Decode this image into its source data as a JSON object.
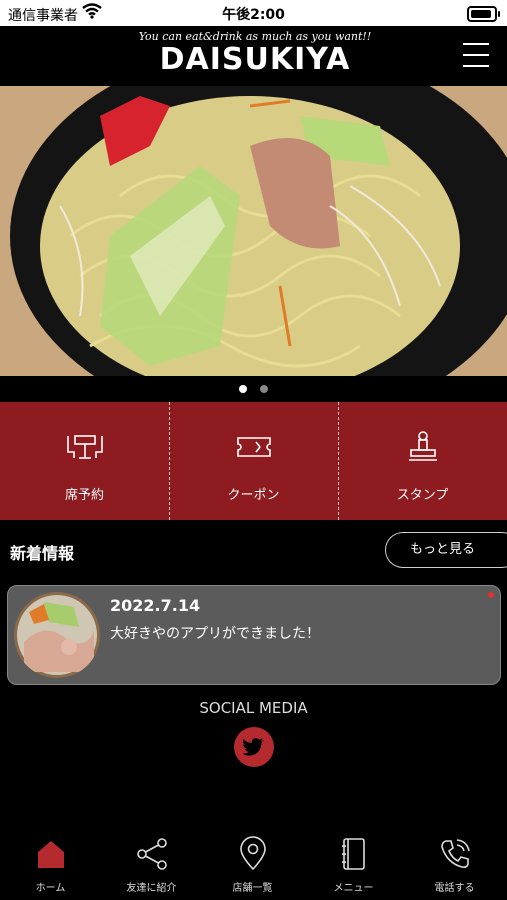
{
  "status_bar": {
    "carrier": "通信事業者",
    "time": "午後2:00"
  },
  "header": {
    "logo_tagline": "You can eat&drink as much as you want!!",
    "logo_name": "DAISUKIYA"
  },
  "hero": {
    "slides_total": 2,
    "active_slide": 1
  },
  "quick_actions": [
    {
      "label": "席予約",
      "icon": "reservation-table-icon"
    },
    {
      "label": "クーポン",
      "icon": "coupon-ticket-icon"
    },
    {
      "label": "スタンプ",
      "icon": "stamp-icon"
    }
  ],
  "news": {
    "section_title": "新着情報",
    "more_label": "もっと見る",
    "items": [
      {
        "date": "2022.7.14",
        "text": "大好きやのアプリができました！",
        "unread": true
      }
    ]
  },
  "social": {
    "title": "SOCIAL MEDIA",
    "icon": "twitter-icon"
  },
  "tabbar": [
    {
      "label": "ホーム",
      "icon": "home-icon",
      "active": true
    },
    {
      "label": "友達に紹介",
      "icon": "share-icon",
      "active": false
    },
    {
      "label": "店舗一覧",
      "icon": "location-pin-icon",
      "active": false
    },
    {
      "label": "メニュー",
      "icon": "menu-book-icon",
      "active": false
    },
    {
      "label": "電話する",
      "icon": "phone-icon",
      "active": false
    }
  ],
  "colors": {
    "brand_red": "#8e1b1f",
    "accent_red": "#b42a2e",
    "card_bg": "#5b5b5b"
  }
}
